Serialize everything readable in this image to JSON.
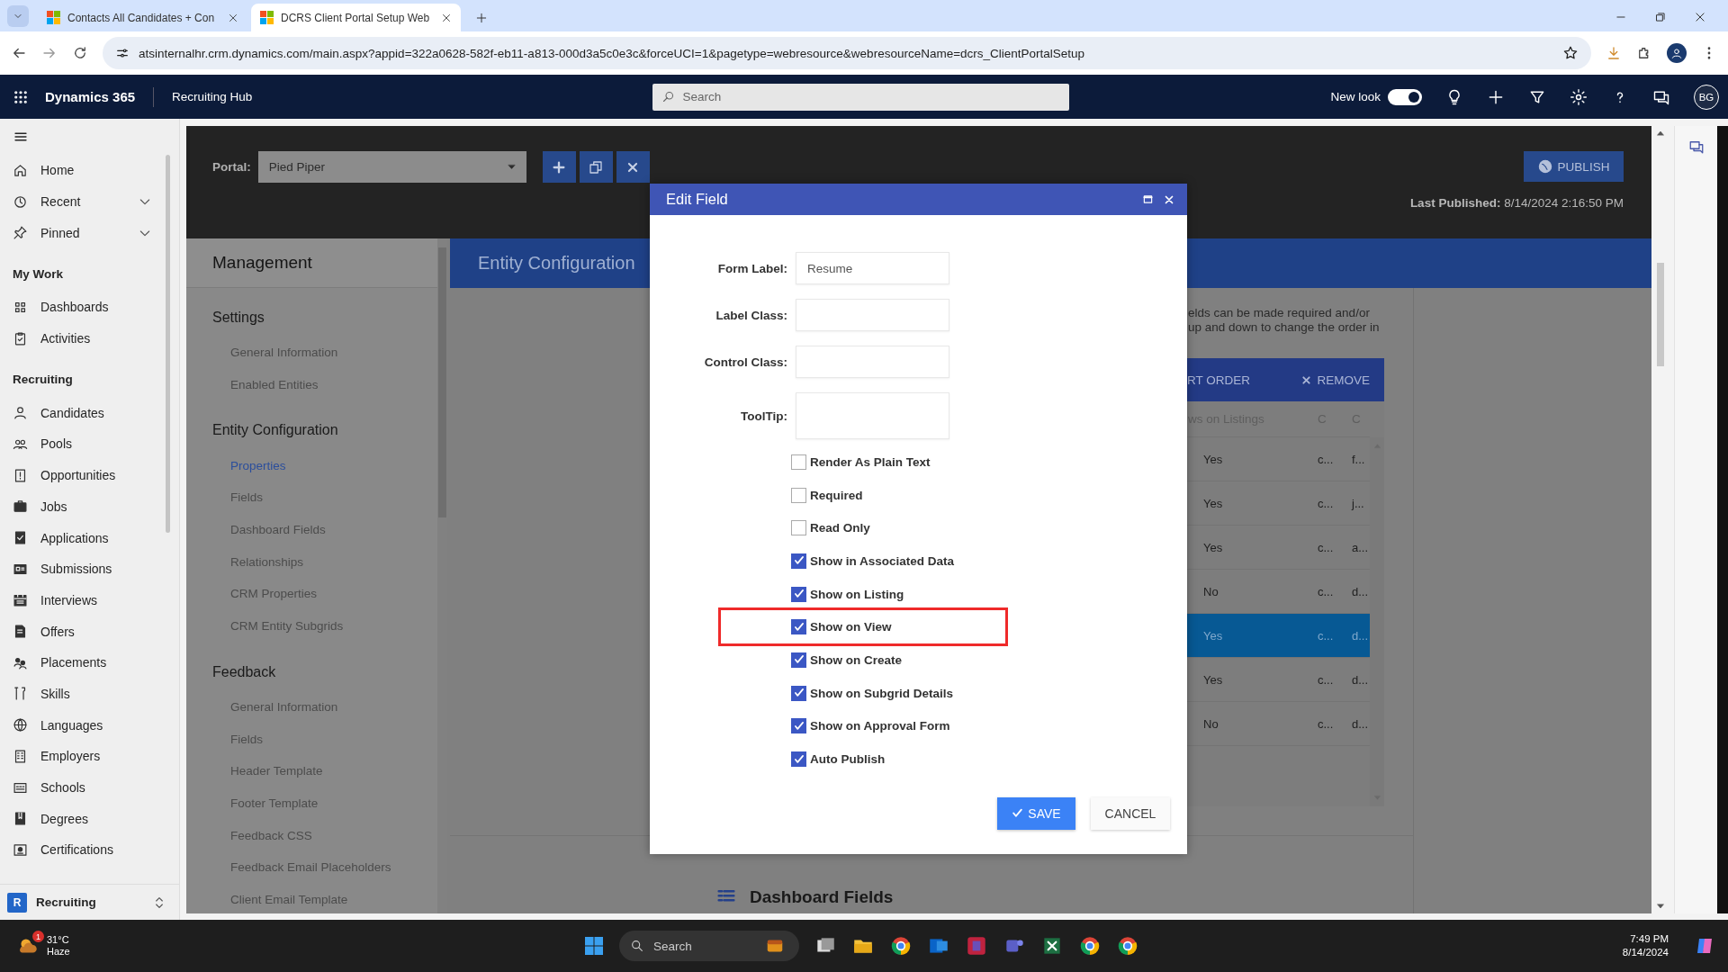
{
  "browser": {
    "tabs": [
      {
        "title": "Contacts All Candidates + Con",
        "selected": false
      },
      {
        "title": "DCRS Client Portal Setup Web",
        "selected": true
      }
    ],
    "url": "atsinternalhr.crm.dynamics.com/main.aspx?appid=322a0628-582f-eb11-a813-000d3a5c0e3c&forceUCI=1&pagetype=webresource&webresourceName=dcrs_ClientPortalSetup"
  },
  "app_header": {
    "app_name": "Dynamics 365",
    "area_name": "Recruiting Hub",
    "search": {
      "placeholder": "Search"
    },
    "new_look": {
      "label": "New look",
      "on": true
    },
    "avatar": "BG"
  },
  "sidebar": {
    "groups": [
      {
        "items": [
          {
            "label": "Home",
            "kind": "link"
          },
          {
            "label": "Recent",
            "kind": "flyout"
          },
          {
            "label": "Pinned",
            "kind": "flyout"
          }
        ]
      },
      {
        "title": "My Work",
        "items": [
          {
            "label": "Dashboards",
            "kind": "link"
          },
          {
            "label": "Activities",
            "kind": "link"
          }
        ]
      },
      {
        "title": "Recruiting",
        "items": [
          {
            "label": "Candidates",
            "kind": "link"
          },
          {
            "label": "Pools",
            "kind": "link"
          },
          {
            "label": "Opportunities",
            "kind": "link"
          },
          {
            "label": "Jobs",
            "kind": "link"
          },
          {
            "label": "Applications",
            "kind": "link"
          },
          {
            "label": "Submissions",
            "kind": "link"
          },
          {
            "label": "Interviews",
            "kind": "link"
          },
          {
            "label": "Offers",
            "kind": "link"
          },
          {
            "label": "Placements",
            "kind": "link"
          },
          {
            "label": "Skills",
            "kind": "link"
          },
          {
            "label": "Languages",
            "kind": "link"
          },
          {
            "label": "Employers",
            "kind": "link"
          },
          {
            "label": "Schools",
            "kind": "link"
          },
          {
            "label": "Degrees",
            "kind": "link"
          },
          {
            "label": "Certifications",
            "kind": "link"
          }
        ]
      }
    ],
    "area_switcher": {
      "badge": "R",
      "label": "Recruiting"
    }
  },
  "portal": {
    "toolbar": {
      "portal_label": "Portal:",
      "portal_value": "Pied Piper",
      "publish": "PUBLISH",
      "last_published": "**Last Published:** 8/14/2024 2:16:50 PM"
    },
    "management": {
      "title": "Management",
      "sections": [
        {
          "title": "Settings",
          "items": [
            {
              "label": "General Information",
              "selected": false
            },
            {
              "label": "Enabled Entities",
              "selected": false
            }
          ]
        },
        {
          "title": "Entity Configuration",
          "items": [
            {
              "label": "Properties",
              "selected": true
            },
            {
              "label": "Fields",
              "selected": false
            },
            {
              "label": "Dashboard Fields",
              "selected": false
            },
            {
              "label": "Relationships",
              "selected": false
            },
            {
              "label": "CRM Properties",
              "selected": false
            },
            {
              "label": "CRM Entity Subgrids",
              "selected": false
            }
          ]
        },
        {
          "title": "Feedback",
          "items": [
            {
              "label": "General Information",
              "selected": false
            },
            {
              "label": "Fields",
              "selected": false
            },
            {
              "label": "Header Template",
              "selected": false
            },
            {
              "label": "Footer Template",
              "selected": false
            },
            {
              "label": "Feedback CSS",
              "selected": false
            },
            {
              "label": "Feedback Email Placeholders",
              "selected": false
            },
            {
              "label": "Client Email Template",
              "selected": false
            }
          ]
        }
      ]
    },
    "content_header": "Entity Configuration",
    "description_lines": [
      "elds can be made required and/or",
      "up and down to change the order in"
    ],
    "grid": {
      "actions": [
        {
          "label": "RT ORDER",
          "kind": "plain"
        },
        {
          "label": "REMOVE",
          "kind": "remove"
        }
      ],
      "columns": [
        "ws on Listings",
        "C",
        "C"
      ],
      "rows": [
        {
          "cells": [
            "Yes",
            "c...",
            "f..."
          ],
          "selected": false
        },
        {
          "cells": [
            "Yes",
            "c...",
            "j..."
          ],
          "selected": false
        },
        {
          "cells": [
            "Yes",
            "c...",
            "a..."
          ],
          "selected": false
        },
        {
          "cells": [
            "No",
            "c...",
            "d..."
          ],
          "selected": false
        },
        {
          "cells": [
            "Yes",
            "c...",
            "d..."
          ],
          "selected": true
        },
        {
          "cells": [
            "Yes",
            "c...",
            "d..."
          ],
          "selected": false
        },
        {
          "cells": [
            "No",
            "c...",
            "d..."
          ],
          "selected": false
        }
      ]
    },
    "next_section": "Dashboard Fields"
  },
  "dialog": {
    "title": "Edit Field",
    "fields": [
      {
        "label": "Form Label:",
        "kind": "input",
        "value": "Resume"
      },
      {
        "label": "Label Class:",
        "kind": "input"
      },
      {
        "label": "Control Class:",
        "kind": "input"
      },
      {
        "label": "ToolTip:",
        "kind": "textarea"
      }
    ],
    "checkboxes": [
      {
        "label": "Render As Plain Text",
        "checked": false,
        "highlighted": false
      },
      {
        "label": "Required",
        "checked": false,
        "highlighted": false
      },
      {
        "label": "Read Only",
        "checked": false,
        "highlighted": false
      },
      {
        "label": "Show in Associated Data",
        "checked": true,
        "highlighted": false
      },
      {
        "label": "Show on Listing",
        "checked": true,
        "highlighted": false
      },
      {
        "label": "Show on View",
        "checked": true,
        "highlighted": true
      },
      {
        "label": "Show on Create",
        "checked": true,
        "highlighted": false
      },
      {
        "label": "Show on Subgrid Details",
        "checked": true,
        "highlighted": false
      },
      {
        "label": "Show on Approval Form",
        "checked": true,
        "highlighted": false
      },
      {
        "label": "Auto Publish",
        "checked": true,
        "highlighted": false
      }
    ],
    "save": "SAVE",
    "cancel": "CANCEL"
  },
  "taskbar": {
    "weather": {
      "temperature": "31°C",
      "condition": "Haze",
      "badge": "1"
    },
    "search": {
      "placeholder": "Search"
    },
    "time": "7:49 PM",
    "date": "8/14/2024"
  }
}
